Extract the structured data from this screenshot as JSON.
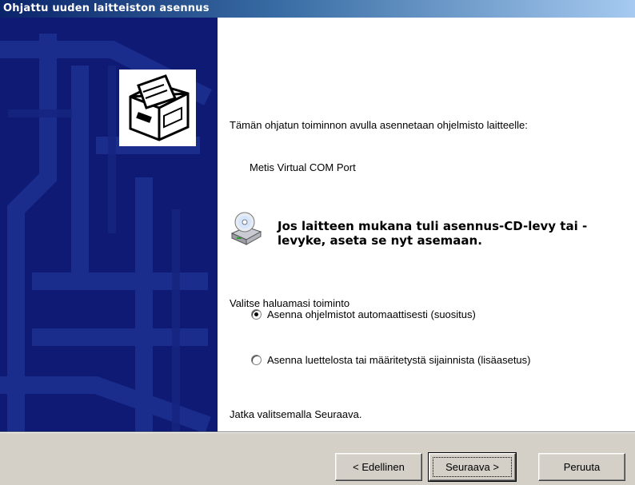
{
  "window": {
    "title": "Ohjattu uuden laitteiston asennus"
  },
  "content": {
    "intro": "Tämän ohjatun toiminnon avulla asennetaan ohjelmisto laitteelle:",
    "device_name": "Metis Virtual COM Port",
    "cd_prompt": "Jos laitteen mukana tuli asennus-CD-levy tai -levyke, aseta se nyt asemaan.",
    "select_label": "Valitse haluamasi toiminto",
    "options": [
      {
        "label": "Asenna ohjelmistot automaattisesti (suositus)",
        "selected": true
      },
      {
        "label": "Asenna luettelosta tai määritetystä sijainnista (lisäasetus)",
        "selected": false
      }
    ],
    "continue_text": "Jatka valitsemalla Seuraava."
  },
  "buttons": {
    "back": "< Edellinen",
    "next": "Seuraava >",
    "cancel": "Peruuta"
  },
  "icons": {
    "wizard": "hardware-wizard-icon",
    "cd": "cd-drive-icon"
  },
  "colors": {
    "titlebar_start": "#0a246a",
    "titlebar_end": "#a6caf0",
    "sidebar": "#0e1a73",
    "button_face": "#d4d0c8"
  }
}
